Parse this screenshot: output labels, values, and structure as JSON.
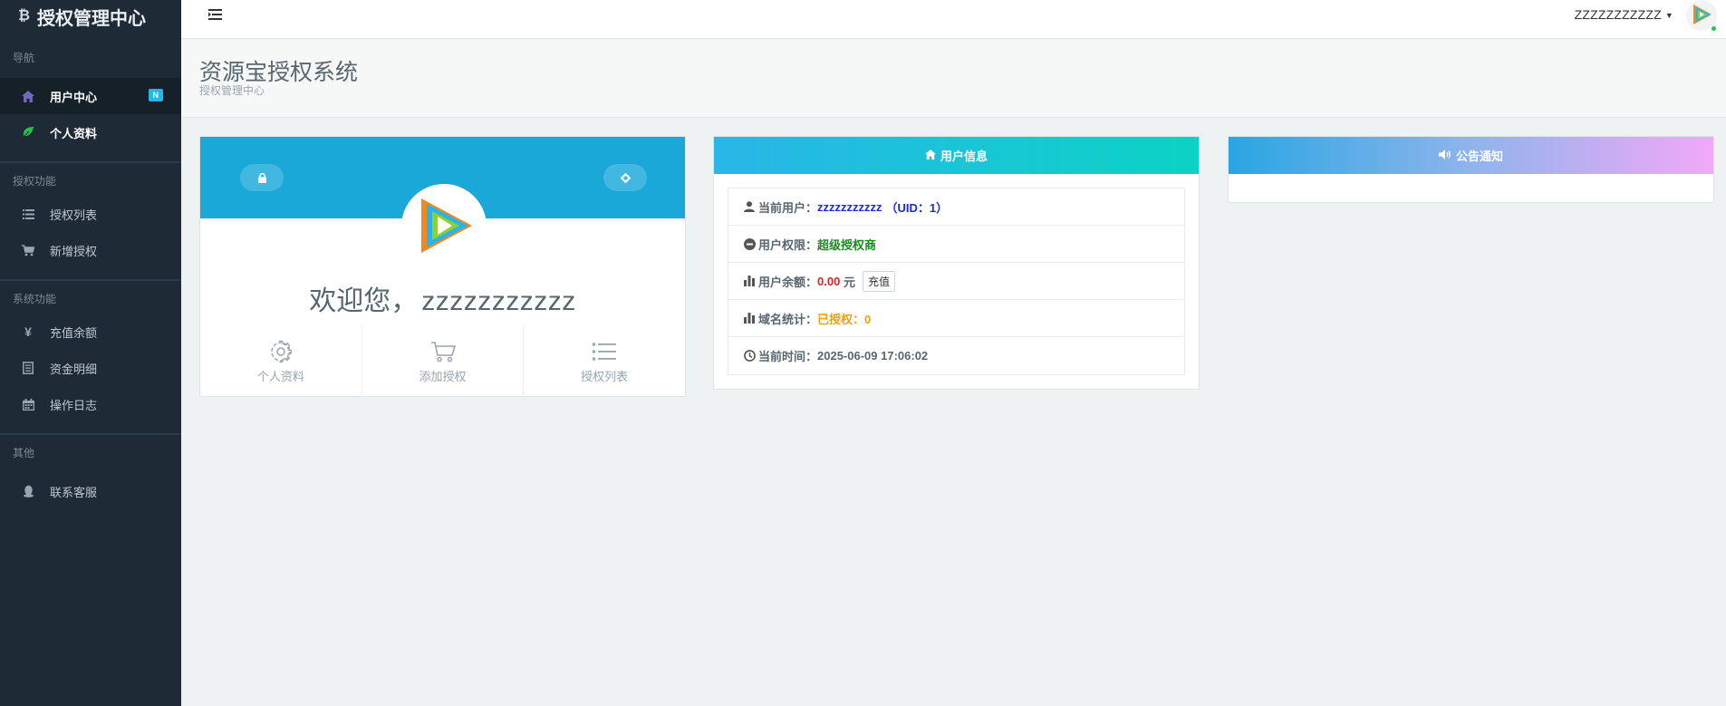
{
  "sidebar": {
    "brand": "授权管理中心",
    "brand_icon": "bitcoin-icon",
    "sections": [
      {
        "title": "导航"
      },
      {
        "title": "授权功能"
      },
      {
        "title": "系统功能"
      },
      {
        "title": "其他"
      }
    ],
    "items": [
      {
        "label": "用户中心",
        "icon": "home-icon",
        "badge": "N"
      },
      {
        "label": "个人资料",
        "icon": "leaf-icon"
      },
      {
        "label": "授权列表",
        "icon": "list-icon"
      },
      {
        "label": "新增授权",
        "icon": "cart-icon"
      },
      {
        "label": "充值余额",
        "icon": "yen-icon"
      },
      {
        "label": "资金明细",
        "icon": "ledger-icon"
      },
      {
        "label": "操作日志",
        "icon": "calendar-icon"
      },
      {
        "label": "联系客服",
        "icon": "qq-icon"
      }
    ]
  },
  "topbar": {
    "username": "ZZZZZZZZZZZ",
    "online": true
  },
  "header": {
    "title": "资源宝授权系统",
    "subtitle": "授权管理中心"
  },
  "profile_card": {
    "greeting": "欢迎您，",
    "username": "zzzzzzzzzzz",
    "actions": [
      {
        "label": "个人资料",
        "icon": "gear-icon"
      },
      {
        "label": "添加授权",
        "icon": "cart-icon"
      },
      {
        "label": "授权列表",
        "icon": "list-icon"
      }
    ],
    "colors": {
      "banner": "#19a8d8"
    }
  },
  "user_info": {
    "title": "用户信息",
    "rows": {
      "current_user": {
        "label": "当前用户：",
        "value": "zzzzzzzzzzz",
        "uid": "（UID：1）"
      },
      "permission": {
        "label": "用户权限：",
        "value": "超级授权商"
      },
      "balance": {
        "label": "用户余额：",
        "value": "0.00",
        "unit": " 元",
        "button": "充值"
      },
      "domains": {
        "label": "域名统计：",
        "value": "已授权：0"
      },
      "time": {
        "label": "当前时间：",
        "value": "2025-06-09 17:06:02"
      }
    }
  },
  "notice": {
    "title": "公告通知"
  }
}
